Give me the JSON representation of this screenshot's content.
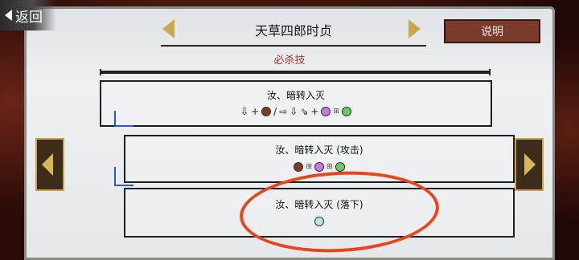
{
  "header": {
    "back_label": "返回",
    "title": "天草四郎时贞",
    "description_button": "说明"
  },
  "section": {
    "label": "必杀技"
  },
  "moves": [
    {
      "name": "汝、暗转入灭",
      "command": "↓+●/→↓↘+●+●"
    },
    {
      "name": "汝、暗转入灭 (攻击)",
      "command": "●+●+●"
    },
    {
      "name": "汝、暗转入灭 (落下)",
      "command": "●"
    }
  ],
  "colors": {
    "accent_gold": "#c9a84c",
    "desc_button": "#7a3a2c",
    "annotation_red": "#e8461a",
    "connector_blue": "#2b58c4"
  },
  "icons": {
    "back": "chevron-left-icon",
    "nav_prev": "triangle-left-icon",
    "nav_next": "triangle-right-icon"
  }
}
